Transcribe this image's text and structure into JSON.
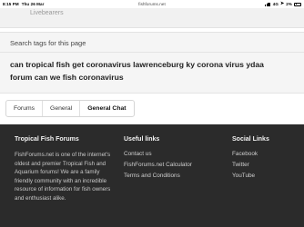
{
  "status_bar": {
    "time": "8:15 PM",
    "date": "Thu 26 Mar",
    "url": "fishforums.net",
    "network": "4G",
    "battery": "2%"
  },
  "previous_list": {
    "item": "Livebearers"
  },
  "tags": {
    "header": "Search tags for this page",
    "text": "can tropical fish get coronavirus lawrenceburg ky corona virus ydaa forum can we fish coronavirus"
  },
  "breadcrumbs": [
    {
      "label": "Forums"
    },
    {
      "label": "General"
    },
    {
      "label": "General Chat"
    }
  ],
  "footer": {
    "about": {
      "title": "Tropical Fish Forums",
      "text": "FishForums.net is one of the internet's oldest and premier Tropical Fish and Aquarium forums! We are a family friendly community with an incredible resource of information for fish owners and enthusiast alike."
    },
    "useful_links": {
      "title": "Useful links",
      "items": [
        "Contact us",
        "FishForums.net Calculator",
        "Terms and Conditions"
      ]
    },
    "social": {
      "title": "Social Links",
      "items": [
        "Facebook",
        "Twitter",
        "YouTube"
      ]
    }
  }
}
